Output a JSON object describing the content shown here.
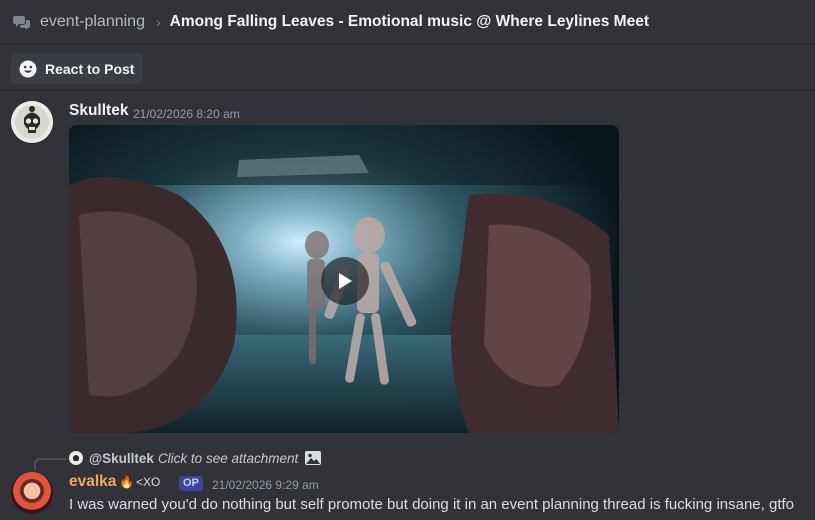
{
  "header": {
    "channel_name": "event-planning",
    "thread_title": "Among Falling Leaves - Emotional music @ Where Leylines Meet"
  },
  "toolbar": {
    "react_label": "React to Post"
  },
  "messages": [
    {
      "author": "Skulltek",
      "author_color": "#f2f3f5",
      "timestamp": "21/02/2026 8:20 am",
      "attachment": "video"
    },
    {
      "reply_to": {
        "mention": "@Skulltek",
        "text": "Click to see attachment"
      },
      "author": "evalka",
      "author_color": "#f0a95a",
      "tags": "<XO",
      "badge": "OP",
      "timestamp": "21/02/2026 9:29 am",
      "content": "I was warned you'd do nothing but self promote but doing it in an event planning thread is fucking insane, gtfo"
    }
  ],
  "colors": {
    "background": "#323339",
    "accent": "#5865f2",
    "timestamp": "#949ba4"
  }
}
